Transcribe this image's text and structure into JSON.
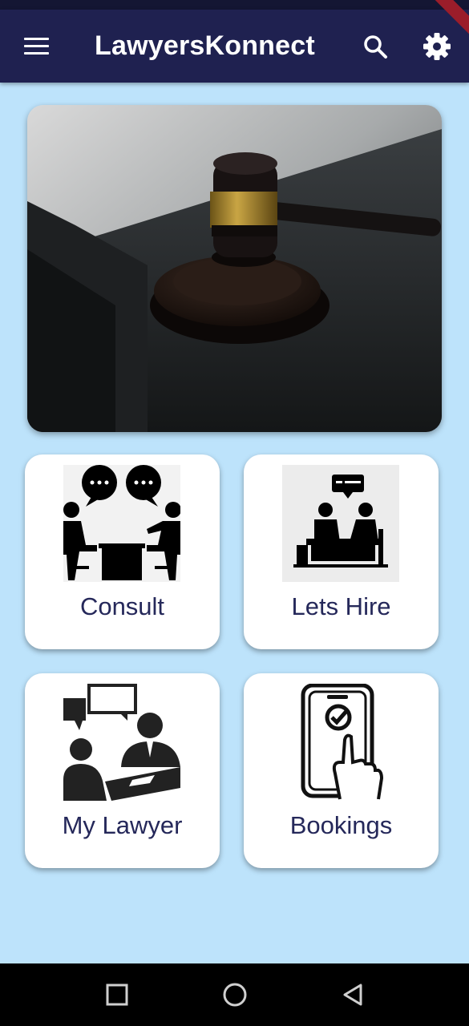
{
  "app_bar": {
    "title": "LawyersKonnect",
    "background": "#1f2150",
    "menu_icon": "menu-icon",
    "search_icon": "search-icon",
    "settings_icon": "gear-icon"
  },
  "hero": {
    "image": "judge-gavel-photo"
  },
  "tiles": [
    {
      "label": "Consult",
      "icon": "consultation-icon"
    },
    {
      "label": "Lets Hire",
      "icon": "hire-lawyer-icon"
    },
    {
      "label": "My Lawyer",
      "icon": "my-lawyer-icon"
    },
    {
      "label": "Bookings",
      "icon": "phone-booking-icon"
    }
  ],
  "colors": {
    "background": "#bde3fb",
    "tile_label": "#25285a",
    "tile_background": "#ffffff"
  },
  "system_nav": {
    "buttons": [
      "recent-apps-icon",
      "home-icon",
      "back-icon"
    ]
  }
}
